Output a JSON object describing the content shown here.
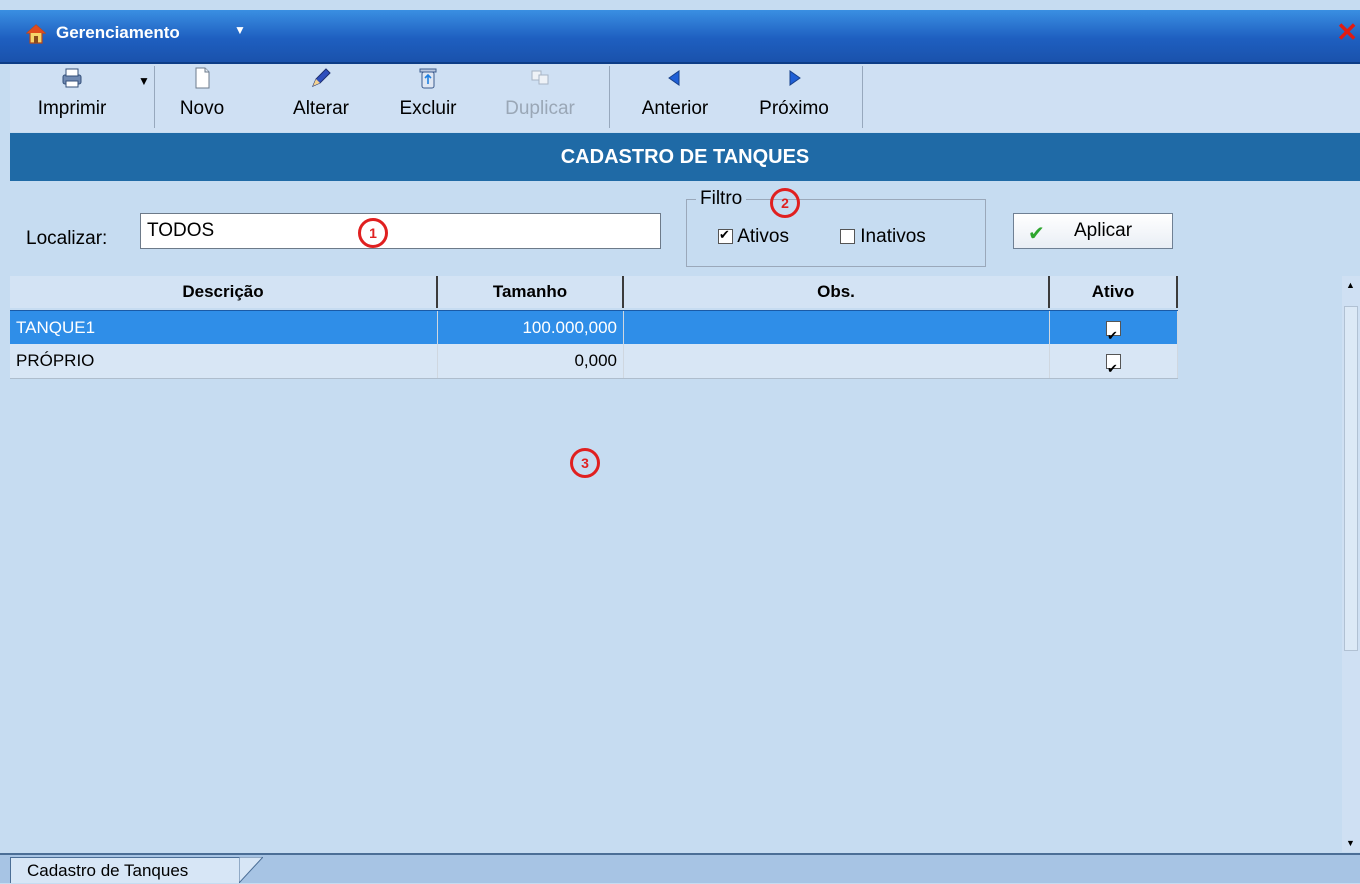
{
  "window": {
    "title": "Gerenciamento",
    "close_glyph": "✕"
  },
  "toolbar": {
    "print": {
      "label": "Imprimir",
      "access": "p",
      "icon": "printer-icon"
    },
    "new": {
      "label": "Novo",
      "access": "N",
      "icon": "new-document-icon"
    },
    "edit": {
      "label": "Alterar",
      "access": "A",
      "icon": "pencil-icon"
    },
    "delete": {
      "label": "Excluir",
      "access": "x",
      "icon": "recycle-bin-icon"
    },
    "duplicate": {
      "label": "Duplicar",
      "access": "D",
      "icon": "duplicate-icon",
      "disabled": true
    },
    "previous": {
      "label": "Anterior",
      "access": "e",
      "icon": "arrow-left-icon"
    },
    "next": {
      "label": "Próximo",
      "access": "r",
      "icon": "arrow-right-icon"
    }
  },
  "banner": {
    "title": "CADASTRO DE TANQUES"
  },
  "search": {
    "label": "Localizar:",
    "value": "TODOS"
  },
  "filter": {
    "legend": "Filtro",
    "active": {
      "label": "Ativos",
      "checked": true
    },
    "inactive": {
      "label": "Inativos",
      "checked": false
    }
  },
  "apply_button": {
    "label": "Aplicar",
    "icon": "checkmark-icon"
  },
  "annotations": [
    "1",
    "2",
    "3"
  ],
  "grid": {
    "columns": [
      "Descrição",
      "Tamanho",
      "Obs.",
      "Ativo"
    ],
    "rows": [
      {
        "descricao": "TANQUE1",
        "tamanho": "100.000,000",
        "obs": "",
        "ativo": true,
        "selected": true
      },
      {
        "descricao": "PRÓPRIO",
        "tamanho": "0,000",
        "obs": "",
        "ativo": true,
        "selected": false
      }
    ]
  },
  "status": {
    "tab_label": "Cadastro de Tanques"
  },
  "colors": {
    "title_bar": "#1e5fc0",
    "banner": "#1f6aa6",
    "background": "#c6dcf1",
    "selection": "#2f8ee8"
  }
}
